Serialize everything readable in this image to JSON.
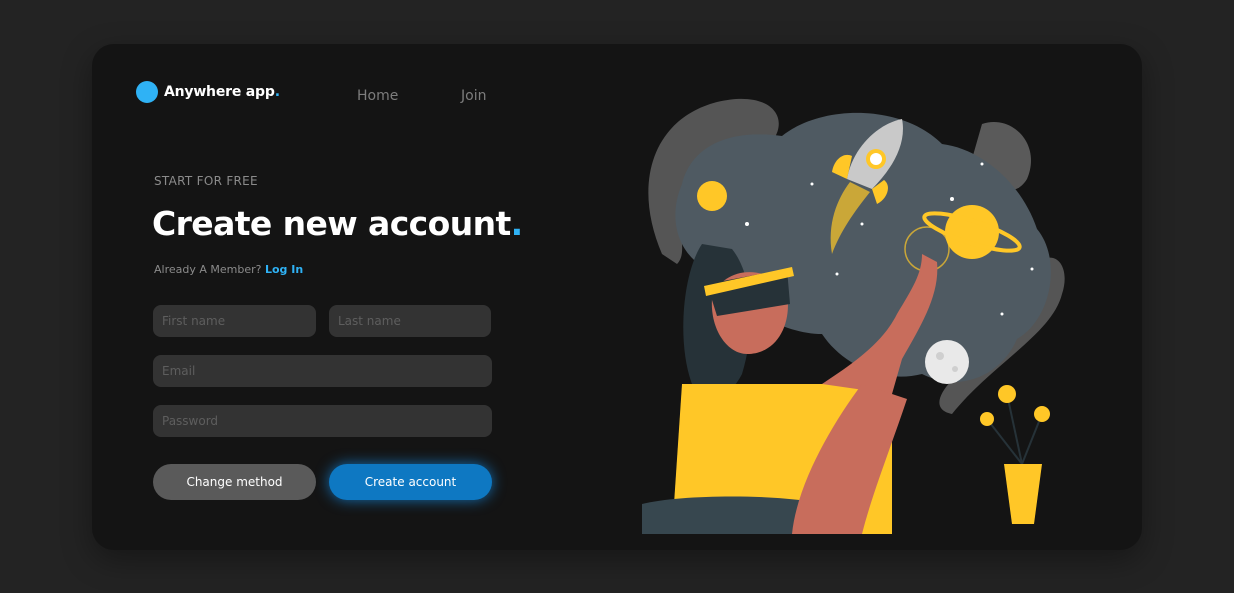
{
  "brand": {
    "name": "Anywhere app",
    "accent_char": "."
  },
  "nav": {
    "home": "Home",
    "join": "Join"
  },
  "hero": {
    "eyebrow": "START FOR FREE",
    "title": "Create new account",
    "title_dot": ".",
    "member_text": "Already A Member?",
    "login_link": "Log In"
  },
  "form": {
    "first_name_placeholder": "First name",
    "last_name_placeholder": "Last name",
    "email_placeholder": "Email",
    "password_placeholder": "Password"
  },
  "buttons": {
    "change_method": "Change method",
    "create_account": "Create account"
  },
  "colors": {
    "accent": "#2fb2f5",
    "primary_button": "#0e78c2",
    "background": "#232323",
    "card": "#141414",
    "illustration_yellow": "#ffc727"
  },
  "illustration": {
    "icon": "vr-space-illustration"
  }
}
